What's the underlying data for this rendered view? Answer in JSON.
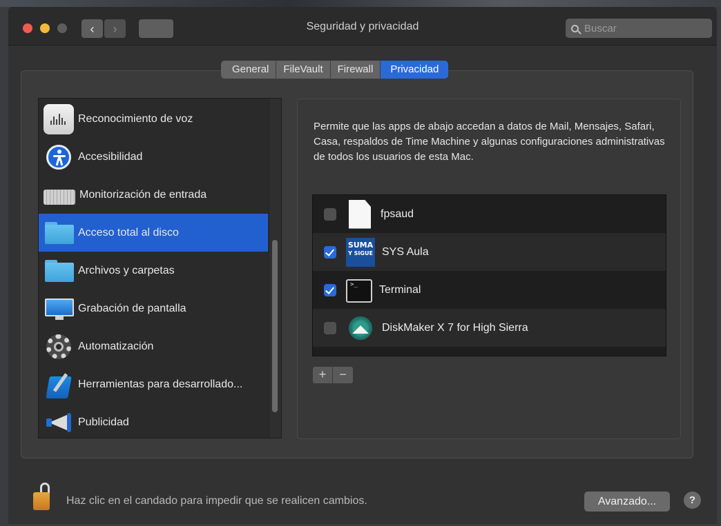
{
  "window": {
    "title": "Seguridad y privacidad",
    "search_placeholder": "Buscar"
  },
  "tabs": [
    {
      "label": "General",
      "active": false
    },
    {
      "label": "FileVault",
      "active": false
    },
    {
      "label": "Firewall",
      "active": false
    },
    {
      "label": "Privacidad",
      "active": true
    }
  ],
  "sidebar": {
    "items": [
      {
        "label": "Reconocimiento de voz",
        "icon": "speech-waveform-icon",
        "selected": false
      },
      {
        "label": "Accesibilidad",
        "icon": "accessibility-icon",
        "selected": false
      },
      {
        "label": "Monitorización de entrada",
        "icon": "keyboard-icon",
        "selected": false
      },
      {
        "label": "Acceso total al disco",
        "icon": "folder-icon",
        "selected": true
      },
      {
        "label": "Archivos y carpetas",
        "icon": "folder-icon",
        "selected": false
      },
      {
        "label": "Grabación de pantalla",
        "icon": "monitor-icon",
        "selected": false
      },
      {
        "label": "Automatización",
        "icon": "gear-icon",
        "selected": false
      },
      {
        "label": "Herramientas para desarrollado...",
        "icon": "xcode-icon",
        "selected": false
      },
      {
        "label": "Publicidad",
        "icon": "megaphone-icon",
        "selected": false
      }
    ]
  },
  "panel": {
    "description": "Permite que las apps de abajo accedan a datos de Mail, Mensajes, Safari, Casa, respaldos de Time Machine y algunas configuraciones administrativas de todos los usuarios de esta Mac.",
    "apps": [
      {
        "name": "fpsaud",
        "checked": false,
        "icon": "document-icon"
      },
      {
        "name": "SYS Aula",
        "checked": true,
        "icon": "suma-app-icon",
        "icon_text": [
          "SUMA",
          "Y SIGUE"
        ]
      },
      {
        "name": "Terminal",
        "checked": true,
        "icon": "terminal-icon",
        "icon_text": ">_"
      },
      {
        "name": "DiskMaker X 7 for High Sierra",
        "checked": false,
        "icon": "diskmaker-icon"
      }
    ],
    "add_label": "+",
    "remove_label": "−"
  },
  "footer": {
    "lock_text": "Haz clic en el candado para impedir que se realicen cambios.",
    "advanced_label": "Avanzado...",
    "help_label": "?"
  },
  "colors": {
    "accent": "#2a6ad8",
    "selection": "#2260d0",
    "window_bg": "#323232"
  }
}
